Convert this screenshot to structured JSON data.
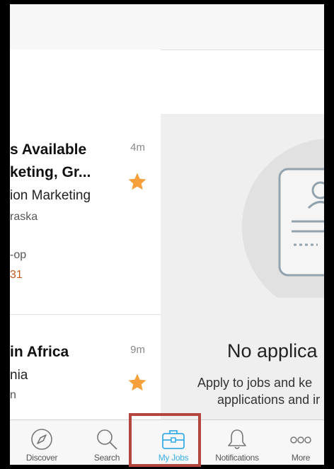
{
  "jobs": [
    {
      "title_line1": "s Available",
      "title_line2": "keting, Gr...",
      "company": "ion Marketing",
      "location": "raska",
      "type": "-op",
      "date": "31",
      "time": "4m",
      "starred": true
    },
    {
      "title_line1": "in Africa",
      "company": "nia",
      "location": "n",
      "time": "9m",
      "starred": true
    }
  ],
  "empty_state": {
    "title": "No applica",
    "line1": "Apply to jobs and ke",
    "line2": "applications and ir"
  },
  "tabs": [
    {
      "label": "Discover",
      "icon": "compass-icon"
    },
    {
      "label": "Search",
      "icon": "search-icon"
    },
    {
      "label": "My Jobs",
      "icon": "briefcase-icon",
      "active": true
    },
    {
      "label": "Notifications",
      "icon": "bell-icon"
    },
    {
      "label": "More",
      "icon": "more-icon"
    }
  ],
  "colors": {
    "accent": "#3aaee6",
    "star": "#f5a03a",
    "date_highlight": "#c0571c",
    "selection_outline": "#b4453f"
  }
}
